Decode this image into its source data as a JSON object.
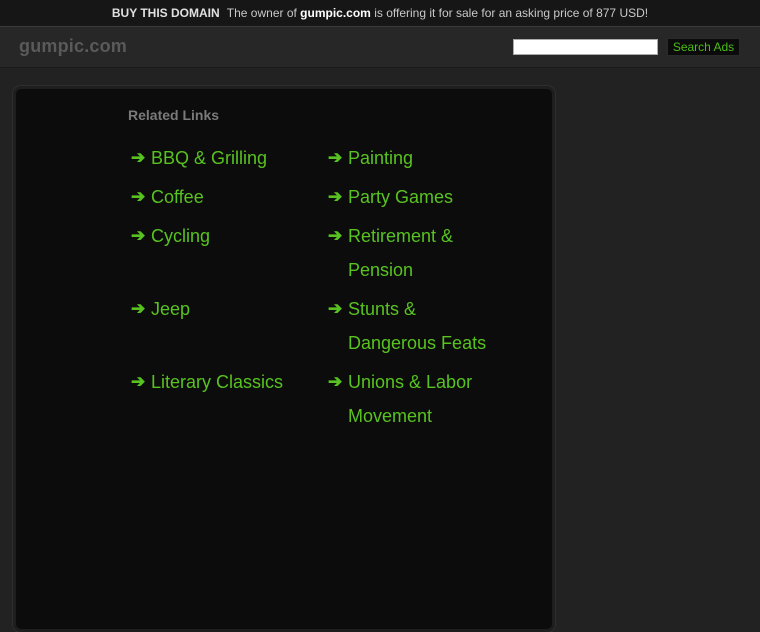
{
  "topbar": {
    "buy_label": "BUY THIS DOMAIN",
    "text_before": "The owner of ",
    "domain": "gumpic.com",
    "text_after": " is offering it for sale for an asking price of 877 USD!"
  },
  "header": {
    "site_name": "gumpic.com",
    "search": {
      "value": "",
      "button_label": "Search Ads"
    }
  },
  "related": {
    "title": "Related Links",
    "arrow_icon": "right-arrow-icon",
    "link_color": "#58c320",
    "left_column": [
      {
        "label": "BBQ & Grilling"
      },
      {
        "label": "Coffee"
      },
      {
        "label": "Cycling"
      },
      {
        "label": "Jeep"
      },
      {
        "label": "Literary Classics"
      }
    ],
    "right_column": [
      {
        "label": "Painting"
      },
      {
        "label": "Party Games"
      },
      {
        "label": "Retirement & Pension"
      },
      {
        "label": "Stunts & Dangerous Feats"
      },
      {
        "label": "Unions & Labor Movement"
      }
    ]
  }
}
